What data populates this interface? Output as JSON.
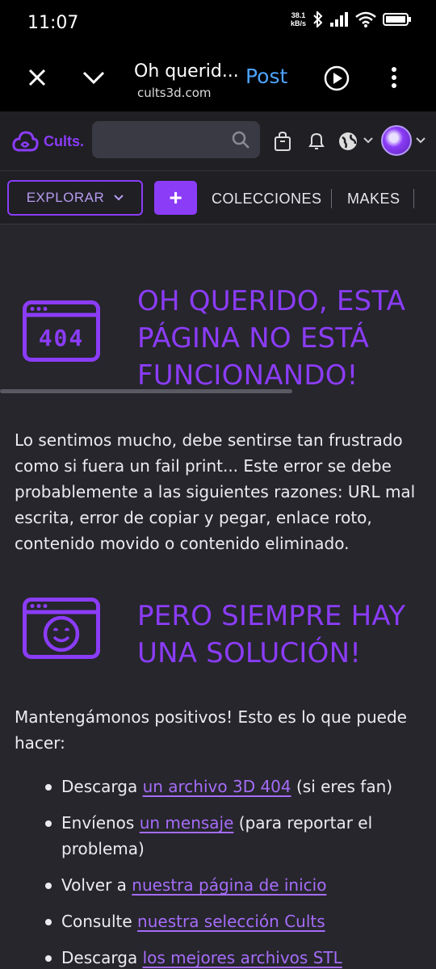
{
  "status_bar": {
    "time": "11:07",
    "net_speed": "38.1",
    "net_unit": "kB/s"
  },
  "browser": {
    "title": "Oh querid...",
    "url": "cults3d.com",
    "post_label": "Post"
  },
  "site": {
    "logo_text": "Cults.",
    "search_placeholder": ""
  },
  "nav": {
    "explorar_label": "EXPLORAR",
    "plus_label": "+",
    "links": [
      "COLECCIONES",
      "MAKES"
    ]
  },
  "error": {
    "heading_lines": [
      "OH QUERIDO, ESTA",
      "PÁGINA NO ESTÁ",
      "FUNCIONANDO!"
    ],
    "icon_text": "404",
    "description": "Lo sentimos mucho, debe sentirse tan frustrado como si fuera un fail print... Este error se debe probablemente a las siguientes razones: URL mal escrita, error de copiar y pegar, enlace roto, contenido movido o contenido eliminado."
  },
  "solution": {
    "heading_lines": [
      "PERO SIEMPRE HAY",
      "UNA SOLUCIÓN!"
    ],
    "intro": "Mantengámonos positivos! Esto es lo que puede hacer:",
    "items": [
      {
        "before": "Descarga ",
        "link": "un archivo 3D 404",
        "after": " (si eres fan)"
      },
      {
        "before": "Envíenos ",
        "link": "un mensaje",
        "after": " (para reportar el problema)"
      },
      {
        "before": "Volver a ",
        "link": "nuestra página de inicio",
        "after": ""
      },
      {
        "before": "Consulte ",
        "link": "nuestra selección Cults",
        "after": ""
      },
      {
        "before": "Descarga ",
        "link": "los mejores archivos STL",
        "after": ""
      }
    ]
  },
  "colors": {
    "accent": "#8b3cf7",
    "link": "#a56cf8",
    "background": "#26262c",
    "header_bg": "#1f1f24",
    "browser_link": "#4da3ff"
  }
}
